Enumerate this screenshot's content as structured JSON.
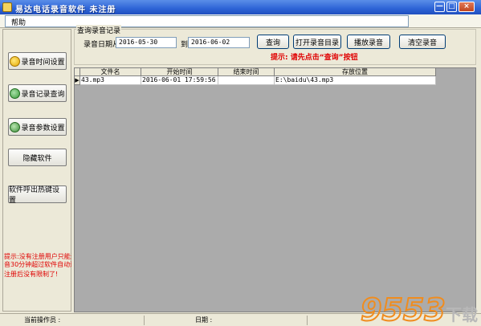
{
  "window": {
    "title": "易达电话录音软件 未注册",
    "min_glyph": "—",
    "max_glyph": "□",
    "close_glyph": "×"
  },
  "menu": {
    "help": "帮助"
  },
  "sidebar": {
    "buttons": {
      "time_settings": "录音时间设置",
      "record_query": "录音记录查询",
      "params_settings": "录音参数设置",
      "hide_software": "隐藏软件",
      "hotkey_settings": "软件呼出热键设置"
    },
    "notice": {
      "line1": "提示:没有注册用户只能录",
      "line2": "音30分钟超过软件自动退出",
      "line3": "注册后没有限制了!"
    }
  },
  "query": {
    "group_title": "查询录音记录",
    "date_from_label": "录音日期从",
    "date_from": "2016-05-30",
    "to_label": "到",
    "date_to": "2016-06-02",
    "buttons": {
      "query": "查询",
      "open_dir": "打开录音目录",
      "play": "播放录音",
      "clear": "清空录音"
    },
    "hint": "提示: 请先点击“查询”按钮"
  },
  "grid": {
    "columns": [
      "文件名",
      "开始时间",
      "结束时间",
      "存放位置"
    ],
    "rows": [
      {
        "indicator": "▶",
        "file": "43.mp3",
        "start": "2016-06-01 17:59:56",
        "end": "",
        "path": "E:\\baidu\\43.mp3"
      }
    ]
  },
  "status": {
    "operator_label": "当前操作员 :",
    "date_label": "日期 :"
  },
  "watermark": {
    "text": "9553",
    "suffix": "下载",
    "colors": {
      "orange": "#f08c1e",
      "gray": "#b8b8b8"
    }
  }
}
